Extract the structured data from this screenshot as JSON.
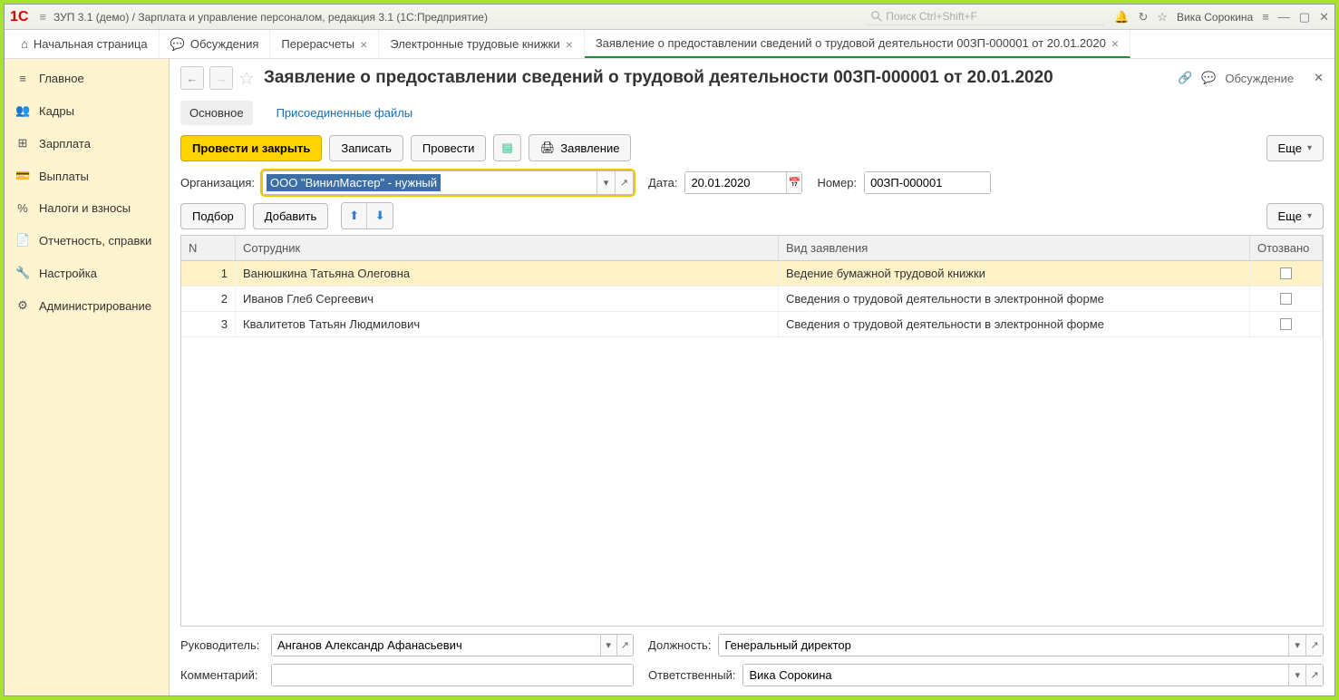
{
  "titlebar": {
    "title": "ЗУП 3.1 (демо) / Зарплата и управление персоналом, редакция 3.1  (1С:Предприятие)",
    "search_placeholder": "Поиск Ctrl+Shift+F",
    "user": "Вика Сорокина"
  },
  "tabs": [
    {
      "label": "Начальная страница",
      "icon": "home"
    },
    {
      "label": "Обсуждения",
      "icon": "chat"
    },
    {
      "label": "Перерасчеты",
      "closeable": true
    },
    {
      "label": "Электронные трудовые книжки",
      "closeable": true
    },
    {
      "label": "Заявление о предоставлении сведений о трудовой деятельности 00ЗП-000001 от 20.01.2020",
      "closeable": true,
      "active": true
    }
  ],
  "sidebar": [
    {
      "label": "Главное",
      "icon": "≡"
    },
    {
      "label": "Кадры",
      "icon": "👥"
    },
    {
      "label": "Зарплата",
      "icon": "⊞"
    },
    {
      "label": "Выплаты",
      "icon": "💳"
    },
    {
      "label": "Налоги и взносы",
      "icon": "%"
    },
    {
      "label": "Отчетность, справки",
      "icon": "📄"
    },
    {
      "label": "Настройка",
      "icon": "🔧"
    },
    {
      "label": "Администрирование",
      "icon": "⚙"
    }
  ],
  "page": {
    "title": "Заявление о предоставлении сведений о трудовой деятельности 00ЗП-000001 от 20.01.2020",
    "discussion": "Обсуждение"
  },
  "subtabs": {
    "main": "Основное",
    "files": "Присоединенные файлы"
  },
  "toolbar": {
    "post_close": "Провести и закрыть",
    "save": "Записать",
    "post": "Провести",
    "print": "Заявление",
    "more": "Еще"
  },
  "form": {
    "org_label": "Организация:",
    "org_value": "ООО \"ВинилМастер\" - нужный",
    "date_label": "Дата:",
    "date_value": "20.01.2020",
    "num_label": "Номер:",
    "num_value": "00ЗП-000001"
  },
  "tabletool": {
    "select": "Подбор",
    "add": "Добавить",
    "more": "Еще"
  },
  "grid": {
    "headers": {
      "n": "N",
      "emp": "Сотрудник",
      "kind": "Вид заявления",
      "rev": "Отозвано"
    },
    "rows": [
      {
        "n": "1",
        "emp": "Ванюшкина Татьяна Олеговна",
        "kind": "Ведение бумажной трудовой книжки",
        "rev": false
      },
      {
        "n": "2",
        "emp": "Иванов Глеб Сергеевич",
        "kind": "Сведения о трудовой деятельности в электронной форме",
        "rev": false
      },
      {
        "n": "3",
        "emp": "Квалитетов Татьян Людмилович",
        "kind": "Сведения о трудовой деятельности в электронной форме",
        "rev": false
      }
    ]
  },
  "footer": {
    "manager_label": "Руководитель:",
    "manager_value": "Анганов Александр Афанасьевич",
    "position_label": "Должность:",
    "position_value": "Генеральный директор",
    "comment_label": "Комментарий:",
    "comment_value": "",
    "responsible_label": "Ответственный:",
    "responsible_value": "Вика Сорокина"
  }
}
